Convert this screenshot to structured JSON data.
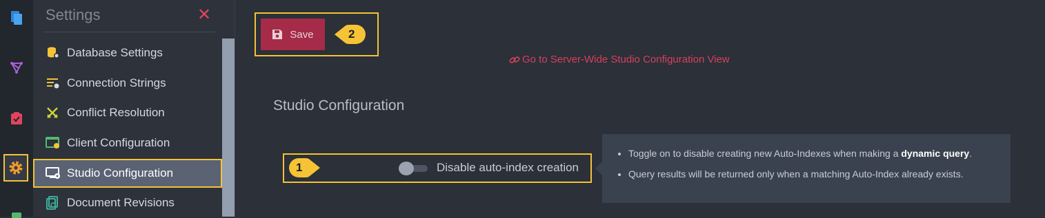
{
  "rail": {
    "icons": [
      "documents-icon",
      "graph-icon",
      "tasks-icon",
      "settings-gear-icon"
    ]
  },
  "menu": {
    "title": "Settings",
    "close_glyph": "✕",
    "items": [
      {
        "label": "Database Settings",
        "icon": "database-settings-icon"
      },
      {
        "label": "Connection Strings",
        "icon": "connection-strings-icon"
      },
      {
        "label": "Conflict Resolution",
        "icon": "conflict-resolution-icon"
      },
      {
        "label": "Client Configuration",
        "icon": "client-configuration-icon"
      },
      {
        "label": "Studio Configuration",
        "icon": "studio-configuration-icon",
        "active": true
      },
      {
        "label": "Document Revisions",
        "icon": "document-revisions-icon"
      }
    ]
  },
  "toolbar": {
    "save_label": "Save"
  },
  "callouts": {
    "save": "2",
    "toggle": "1"
  },
  "server_link": {
    "text": "Go to Server-Wide Studio Configuration View"
  },
  "section": {
    "title": "Studio Configuration"
  },
  "toggle": {
    "label": "Disable auto-index creation",
    "checked": false
  },
  "info": {
    "line1_prefix": "Toggle on to disable creating new Auto-Indexes when making a ",
    "line1_bold": "dynamic query",
    "line1_suffix": ".",
    "line2": "Query results will be returned only when a matching Auto-Index already exists."
  },
  "colors": {
    "accent_highlight": "#f5c335",
    "save_button": "#a52b48",
    "link": "#d8405c",
    "active_menu": "#5a6274"
  }
}
